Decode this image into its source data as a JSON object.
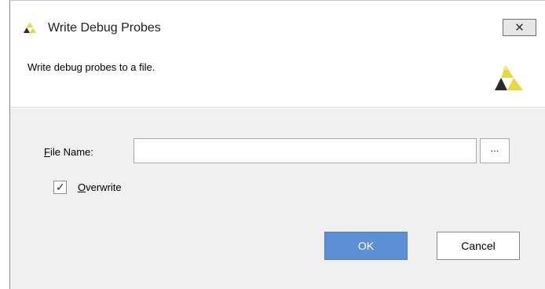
{
  "window": {
    "title": "Write Debug Probes",
    "close_glyph": "✕",
    "app_icon": "vivado-logo-icon"
  },
  "header": {
    "description": "Write debug probes to a file.",
    "logo_icon": "vivado-logo-icon"
  },
  "form": {
    "file_name_mnemonic": "F",
    "file_name_rest": "ile Name:",
    "file_name_value": "",
    "browse_label": "...",
    "overwrite_mnemonic": "O",
    "overwrite_rest": "verwrite",
    "overwrite_checked": true,
    "checkmark": "✓"
  },
  "buttons": {
    "ok_label": "OK",
    "cancel_label": "Cancel"
  },
  "colors": {
    "accent": "#5d8fd6",
    "logo_primary": "#2a2a2a",
    "logo_secondary": "#e8d93a"
  }
}
